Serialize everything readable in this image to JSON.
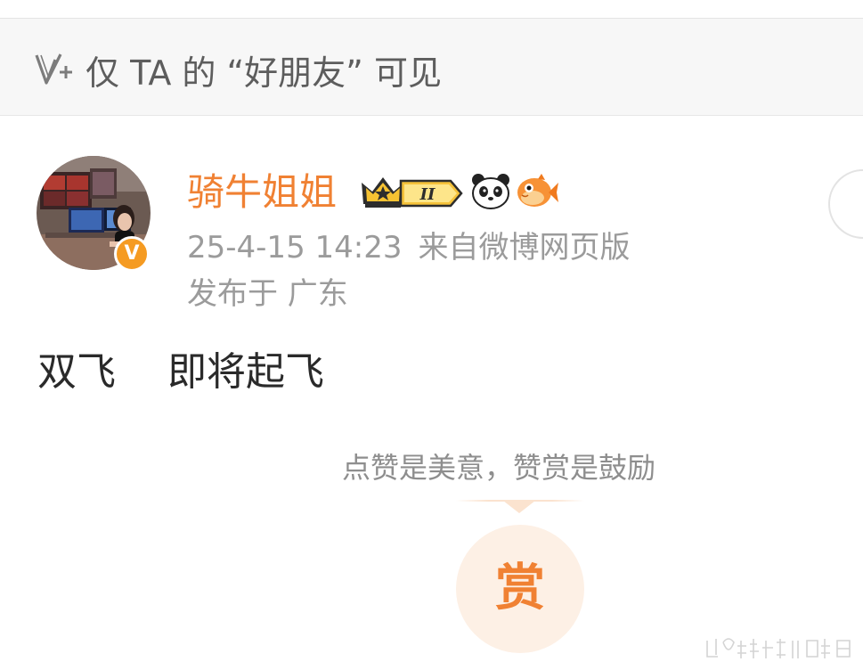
{
  "privacy": {
    "icon": "visibility-v-plus-icon",
    "text": "仅 TA 的 “好朋友” 可见"
  },
  "post": {
    "author": {
      "name": "骑牛姐姐",
      "avatar": "avatar-photo",
      "verified_badge": "V",
      "badges": [
        "crown-icon",
        "level-badge",
        "panda-icon",
        "fish-icon"
      ],
      "level_label": "II"
    },
    "timestamp": "25-4-15 14:23",
    "source": "来自微博网页版",
    "location": "发布于 广东",
    "text": "双飞　 即将起飞"
  },
  "reward": {
    "tip": "点赞是美意，赞赏是鼓励",
    "button_label": "赏"
  },
  "colors": {
    "accent": "#f08133",
    "meta_text": "#9b9b9b",
    "privacy_bg": "#f7f7f7",
    "reward_bg": "#fdf0e5"
  }
}
